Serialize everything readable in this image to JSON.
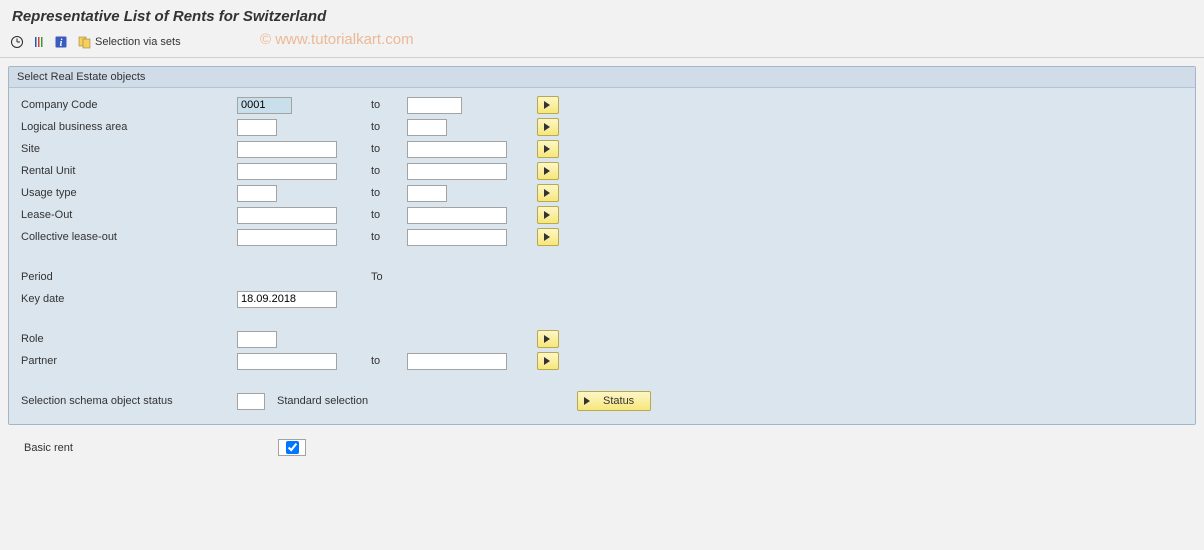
{
  "header": {
    "title": "Representative List of Rents for Switzerland"
  },
  "toolbar": {
    "selection_via_sets_label": "Selection via sets"
  },
  "watermark": "© www.tutorialkart.com",
  "groupbox": {
    "title": "Select Real Estate objects",
    "rows": {
      "company_code": {
        "label": "Company Code",
        "from": "0001",
        "to_label": "to",
        "to": ""
      },
      "logical_business_area": {
        "label": "Logical business area",
        "from": "",
        "to_label": "to",
        "to": ""
      },
      "site": {
        "label": "Site",
        "from": "",
        "to_label": "to",
        "to": ""
      },
      "rental_unit": {
        "label": "Rental Unit",
        "from": "",
        "to_label": "to",
        "to": ""
      },
      "usage_type": {
        "label": "Usage type",
        "from": "",
        "to_label": "to",
        "to": ""
      },
      "lease_out": {
        "label": "Lease-Out",
        "from": "",
        "to_label": "to",
        "to": ""
      },
      "collective_lease_out": {
        "label": "Collective lease-out",
        "from": "",
        "to_label": "to",
        "to": ""
      },
      "period": {
        "label": "Period",
        "to_label": "To"
      },
      "key_date": {
        "label": "Key date",
        "value": "18.09.2018"
      },
      "role": {
        "label": "Role",
        "from": ""
      },
      "partner": {
        "label": "Partner",
        "from": "",
        "to_label": "to",
        "to": ""
      },
      "schema": {
        "label": "Selection schema object status",
        "static": "Standard selection",
        "status_btn": "Status"
      }
    }
  },
  "basic_rent": {
    "label": "Basic rent",
    "checked": true
  }
}
